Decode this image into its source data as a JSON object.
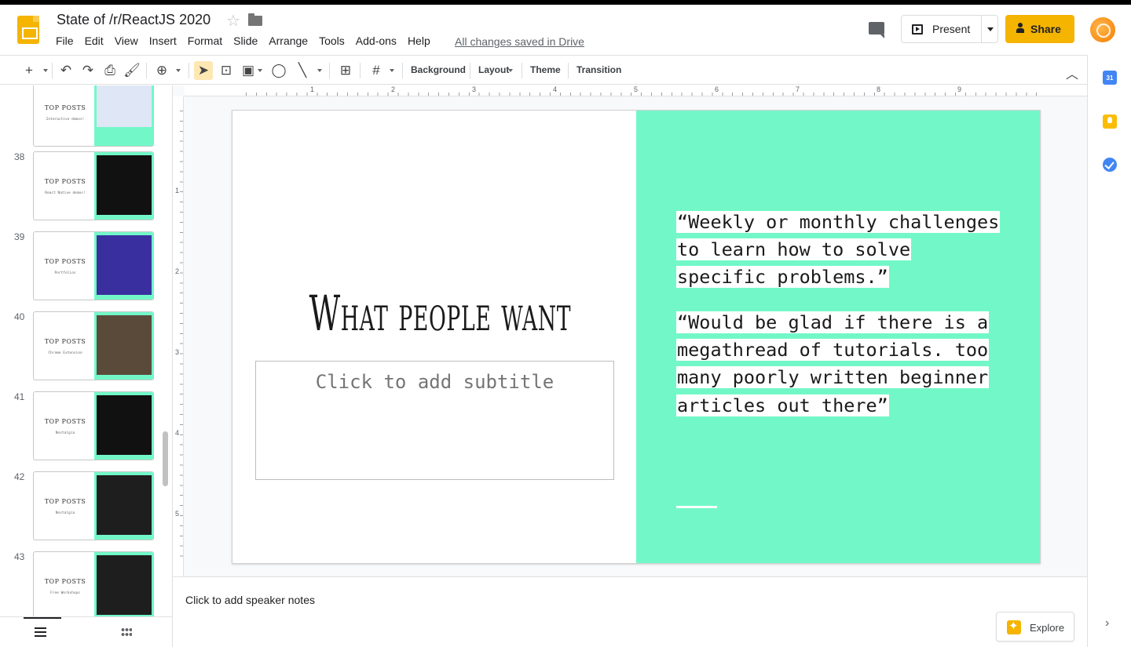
{
  "doc": {
    "title": "State of /r/ReactJS 2020",
    "saved_status": "All changes saved in Drive"
  },
  "menu": [
    "File",
    "Edit",
    "View",
    "Insert",
    "Format",
    "Slide",
    "Arrange",
    "Tools",
    "Add-ons",
    "Help"
  ],
  "header": {
    "present_label": "Present",
    "share_label": "Share"
  },
  "toolbar": {
    "background_label": "Background",
    "layout_label": "Layout",
    "theme_label": "Theme",
    "transition_label": "Transition"
  },
  "ruler": {
    "h_numbers": [
      "1",
      "2",
      "3",
      "4",
      "5",
      "6",
      "7",
      "8",
      "9"
    ],
    "v_numbers": [
      "1",
      "2",
      "3",
      "4",
      "5"
    ]
  },
  "filmstrip": {
    "slides": [
      {
        "number": "",
        "title": "TOP POSTS",
        "subtitle": "Interactive demos!"
      },
      {
        "number": "38",
        "title": "TOP POSTS",
        "subtitle": "React Native demos!"
      },
      {
        "number": "39",
        "title": "TOP POSTS",
        "subtitle": "Portfolios"
      },
      {
        "number": "40",
        "title": "TOP POSTS",
        "subtitle": "Chrome Extension"
      },
      {
        "number": "41",
        "title": "TOP POSTS",
        "subtitle": "Nostalgia"
      },
      {
        "number": "42",
        "title": "TOP POSTS",
        "subtitle": "Nostalgia"
      },
      {
        "number": "43",
        "title": "TOP POSTS",
        "subtitle": "Free Workshops"
      }
    ]
  },
  "slide": {
    "title": "What people want",
    "subtitle_placeholder": "Click to add subtitle",
    "quote_1": "“Weekly or monthly challenges to learn how to solve specific problems.”",
    "quote_2": "“Would be glad if there is a megathread of tutorials. too many poorly written beginner articles out there”",
    "accent_color": "#72f8c8"
  },
  "notes": {
    "placeholder": "Click to add speaker notes"
  },
  "explore": {
    "label": "Explore"
  },
  "side_panel": {
    "calendar_day": "31"
  }
}
